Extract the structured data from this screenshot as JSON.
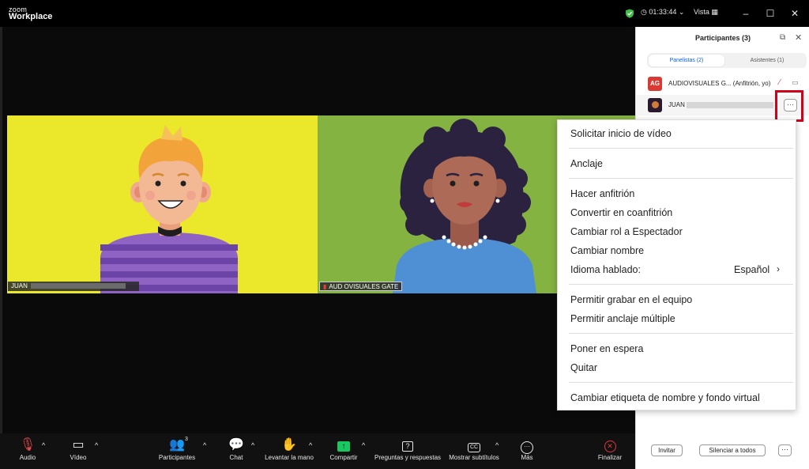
{
  "titlebar": {
    "logo_small": "zoom",
    "logo_product": "Workplace",
    "timer": "◷ 01:33:44  ⌄",
    "view": "Vista  ▦",
    "minimize": "–",
    "maximize": "☐",
    "close": "✕",
    "colors": {
      "shield": "#3fbf4a"
    }
  },
  "videos": {
    "left": {
      "name": "JUAN",
      "bg": "#ebe72a"
    },
    "right": {
      "name": "AUD OVISUALES GATE",
      "bg": "#85b341"
    }
  },
  "toolbar": {
    "audio": {
      "icon": "mic-muted-icon",
      "label": "Audio"
    },
    "video": {
      "icon": "video-camera-icon",
      "label": "Vídeo"
    },
    "participants": {
      "icon": "participants-icon",
      "label": "Participantes",
      "count": "3"
    },
    "chat": {
      "icon": "chat-icon",
      "label": "Chat"
    },
    "raise_hand": {
      "icon": "hand-icon",
      "label": "Levantar la mano"
    },
    "share": {
      "icon": "share-screen-icon",
      "label": "Compartir"
    },
    "qa": {
      "icon": "question-icon",
      "label": "Preguntas y respuestas"
    },
    "captions": {
      "icon": "cc-icon",
      "label": "Mostrar subtítulos"
    },
    "more": {
      "icon": "more-icon",
      "label": "Más"
    },
    "end": {
      "icon": "end-icon",
      "label": "Finalizar"
    },
    "caret": "^"
  },
  "panel": {
    "title": "Participantes (3)",
    "tabs": [
      {
        "label": "Panelistas (2)",
        "active": true
      },
      {
        "label": "Asistentes (1)",
        "active": false
      }
    ],
    "participants": [
      {
        "initials": "AG",
        "name": "AUDIOVISUALES G... (Anfitrión, yo)",
        "avatar_color": "#d93a33"
      },
      {
        "initials": "",
        "name": "JUAN",
        "avatar_color": "#2a1a2e"
      }
    ],
    "more_label": "···",
    "footer": {
      "invite": "Invitar",
      "mute_all": "Silenciar a todos",
      "more": "···"
    }
  },
  "menu": {
    "items": [
      "Solicitar inicio de vídeo",
      "Anclaje",
      "Hacer anfitrión",
      "Convertir en coanfitrión",
      "Cambiar rol a Espectador",
      "Cambiar nombre",
      "Idioma hablado:",
      "Permitir grabar en el equipo",
      "Permitir anclaje múltiple",
      "Poner en espera",
      "Quitar",
      "Cambiar etiqueta de nombre y fondo virtual"
    ],
    "language_value": "Español",
    "language_chevron": "›"
  }
}
